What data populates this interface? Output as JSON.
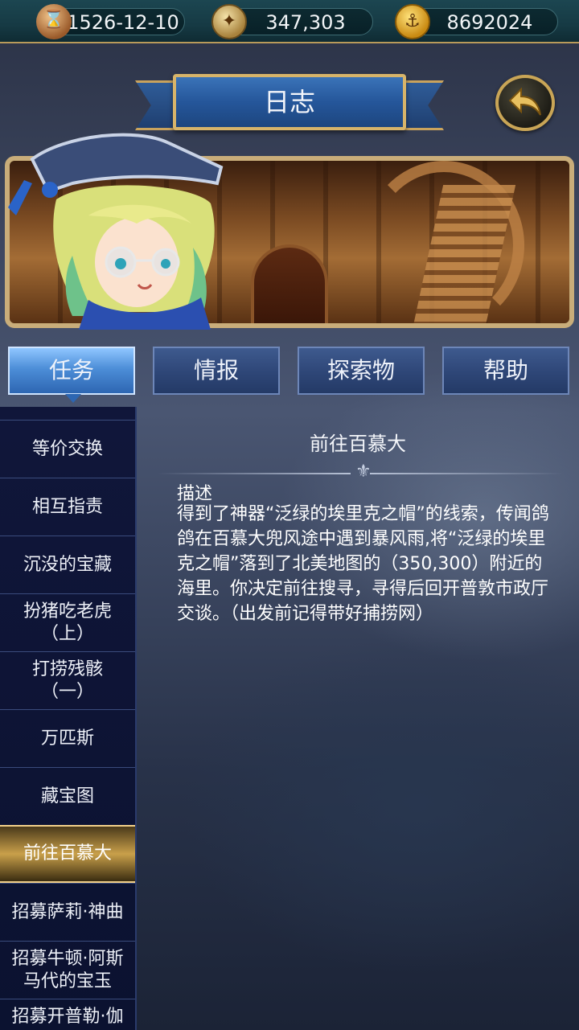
{
  "resources": {
    "date": "1526-12-10",
    "compass_value": "347,303",
    "gold_value": "8692024"
  },
  "header": {
    "title": "日志"
  },
  "tabs": [
    {
      "label": "任务",
      "active": true
    },
    {
      "label": "情报",
      "active": false
    },
    {
      "label": "探索物",
      "active": false
    },
    {
      "label": "帮助",
      "active": false
    }
  ],
  "quests": [
    {
      "label": "等价交换"
    },
    {
      "label": "相互指责"
    },
    {
      "label": "沉没的宝藏"
    },
    {
      "label": "扮猪吃老虎\n（上）"
    },
    {
      "label": "打捞残骸\n（一）"
    },
    {
      "label": "万匹斯"
    },
    {
      "label": "藏宝图"
    },
    {
      "label": "前往百慕大",
      "selected": true
    },
    {
      "label": "招募萨莉·神曲"
    },
    {
      "label": "招募牛顿·阿斯\n马代的宝玉"
    },
    {
      "label": "招募开普勒·伽"
    }
  ],
  "detail": {
    "title": "前往百慕大",
    "description_heading": "描述",
    "description": "得到了神器“泛绿的埃里克之帽”的线索，传闻鸽鸽在百慕大兜风途中遇到暴风雨,将“泛绿的埃里克之帽”落到了北美地图的（350,300）附近的海里。你决定前往搜寻，寻得后回开普敦市政厅交谈。（出发前记得带好捕捞网）"
  },
  "icons": {
    "date": "hourglass-icon",
    "compass": "compass-icon",
    "gold": "anchor-coin-icon",
    "back": "back-arrow-icon"
  },
  "colors": {
    "tab_active": "#4d8ed8",
    "tab_inactive": "#2e4677",
    "list_selected": "#c9a04a",
    "banner": "#25569a"
  }
}
